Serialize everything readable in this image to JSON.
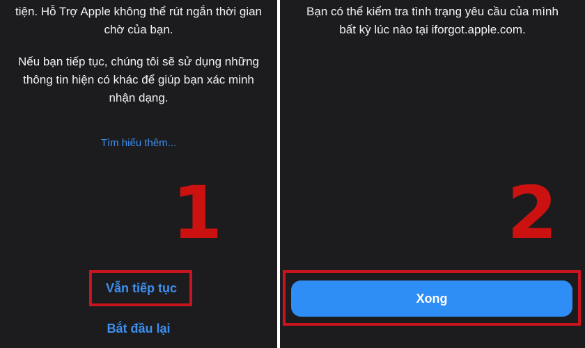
{
  "left_screen": {
    "intro_lines": [
      "tiện. Hỗ Trợ Apple không thể rút ngắn thời gian",
      "chờ của bạn."
    ],
    "info_lines": [
      "Nếu bạn tiếp tục, chúng tôi sẽ sử dụng những",
      "thông tin hiện có khác để giúp bạn xác minh",
      "nhận dạng."
    ],
    "learn_more_link": "Tìm hiểu thêm...",
    "step_number": "1",
    "continue_label": "Vẫn tiếp tục",
    "restart_label": "Bắt đầu lại"
  },
  "right_screen": {
    "status_lines": [
      "Bạn có thể kiểm tra tình trạng yêu cầu của mình",
      "bất kỳ lúc nào tại iforgot.apple.com."
    ],
    "step_number": "2",
    "done_label": "Xong"
  },
  "colors": {
    "background": "#1c1c1e",
    "link": "#3d8ff0",
    "primary_button": "#2f8ef5",
    "highlight": "#c8141e",
    "divider": "#ffffff"
  }
}
